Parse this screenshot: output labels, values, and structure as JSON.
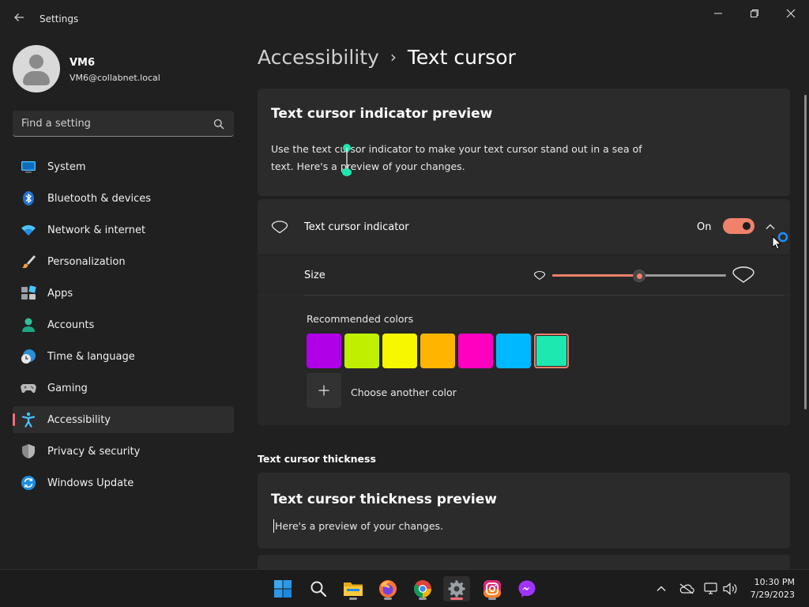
{
  "window": {
    "title": "Settings",
    "back_icon": "arrow-left-icon",
    "controls": [
      "minimize-icon",
      "maximize-icon",
      "close-icon"
    ]
  },
  "user": {
    "name": "VM6",
    "email": "VM6@collabnet.local"
  },
  "search": {
    "placeholder": "Find a setting",
    "value": ""
  },
  "sidebar": {
    "items": [
      {
        "label": "System",
        "icon": "monitor-icon",
        "active": false
      },
      {
        "label": "Bluetooth & devices",
        "icon": "bluetooth-icon",
        "active": false
      },
      {
        "label": "Network & internet",
        "icon": "wifi-icon",
        "active": false
      },
      {
        "label": "Personalization",
        "icon": "paintbrush-icon",
        "active": false
      },
      {
        "label": "Apps",
        "icon": "apps-icon",
        "active": false
      },
      {
        "label": "Accounts",
        "icon": "person-icon",
        "active": false
      },
      {
        "label": "Time & language",
        "icon": "clock-globe-icon",
        "active": false
      },
      {
        "label": "Gaming",
        "icon": "gamepad-icon",
        "active": false
      },
      {
        "label": "Accessibility",
        "icon": "accessibility-icon",
        "active": true
      },
      {
        "label": "Privacy & security",
        "icon": "shield-icon",
        "active": false
      },
      {
        "label": "Windows Update",
        "icon": "update-icon",
        "active": false
      }
    ]
  },
  "breadcrumb": {
    "parent": "Accessibility",
    "separator": "›",
    "current": "Text cursor"
  },
  "preview": {
    "title": "Text cursor indicator preview",
    "text": "Use the text cursor indicator to make your text cursor stand out in a sea of text. Here's a preview of your changes."
  },
  "indicator": {
    "label": "Text cursor indicator",
    "state_label": "On",
    "enabled": true,
    "size_label": "Size",
    "size_level": 0.5,
    "colors_label": "Recommended colors",
    "colors": [
      "#B000E8",
      "#BFF000",
      "#F7F700",
      "#FFB400",
      "#FF00C0",
      "#00B8FF",
      "#1CE8B0"
    ],
    "selected_color": "#1CE8B0",
    "accent": "#F0816B",
    "add_color_label": "Choose another color"
  },
  "thickness": {
    "section_title": "Text cursor thickness",
    "preview_title": "Text cursor thickness preview",
    "preview_text": "Here's a preview of your changes."
  },
  "taskbar": {
    "apps": [
      "windows-start-icon",
      "search-icon",
      "file-explorer-icon",
      "firefox-icon",
      "chrome-icon",
      "settings-gear-icon",
      "instagram-icon",
      "messenger-icon"
    ],
    "active_app": "settings-gear-icon",
    "tray": [
      "chevron-up-icon",
      "onedrive-icon",
      "network-icon",
      "volume-icon"
    ],
    "time": "10:30 PM",
    "date": "7/29/2023"
  }
}
